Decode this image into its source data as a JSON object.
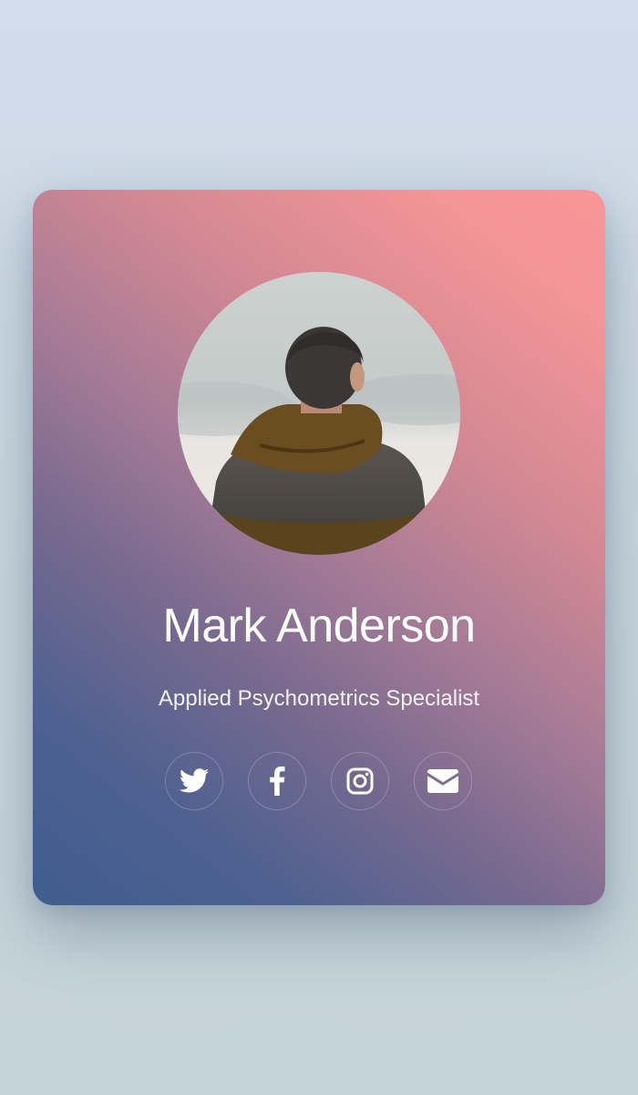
{
  "profile": {
    "name": "Mark Anderson",
    "title": "Applied Psychometrics Specialist",
    "avatar_icon": "person-photo"
  },
  "social": [
    {
      "icon": "twitter-icon"
    },
    {
      "icon": "facebook-icon"
    },
    {
      "icon": "instagram-icon"
    },
    {
      "icon": "email-icon"
    }
  ],
  "colors": {
    "gradient_start": "#3f5d8f",
    "gradient_end": "#f89697",
    "text": "#ffffff"
  }
}
